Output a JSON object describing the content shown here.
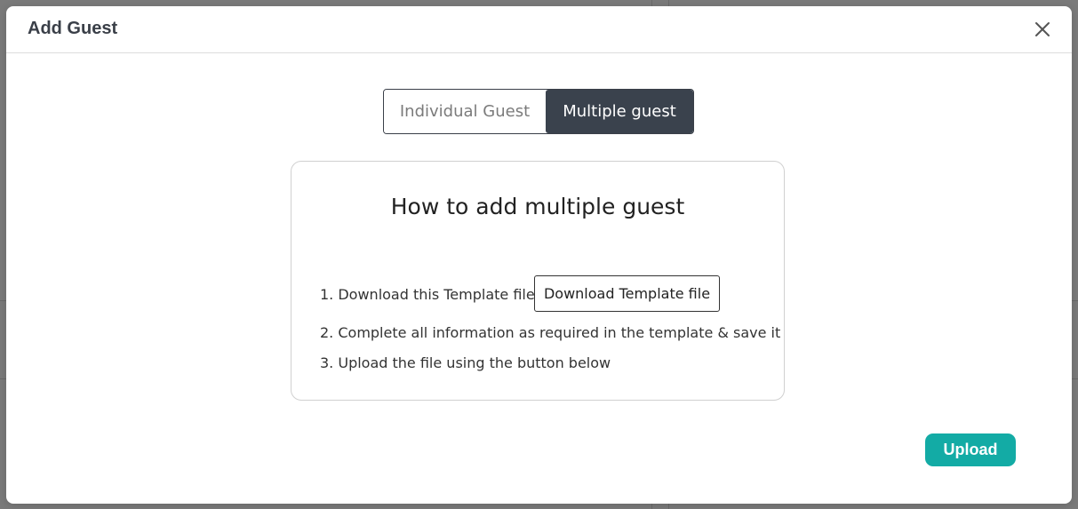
{
  "modal": {
    "title": "Add Guest",
    "close_icon": "close-icon"
  },
  "toggle": {
    "options": [
      {
        "label": "Individual Guest",
        "active": false
      },
      {
        "label": "Multiple guest",
        "active": true
      }
    ]
  },
  "instructions": {
    "title": "How to add multiple guest",
    "steps": [
      "1. Download this Template file",
      "2. Complete all information as required in the template & save it",
      "3. Upload the file using the button below"
    ],
    "download_button": "Download Template file"
  },
  "footer": {
    "upload_button": "Upload"
  },
  "colors": {
    "accent": "#13aba5",
    "toggle_active_bg": "#3a424d",
    "title_text": "#3a3f48"
  }
}
